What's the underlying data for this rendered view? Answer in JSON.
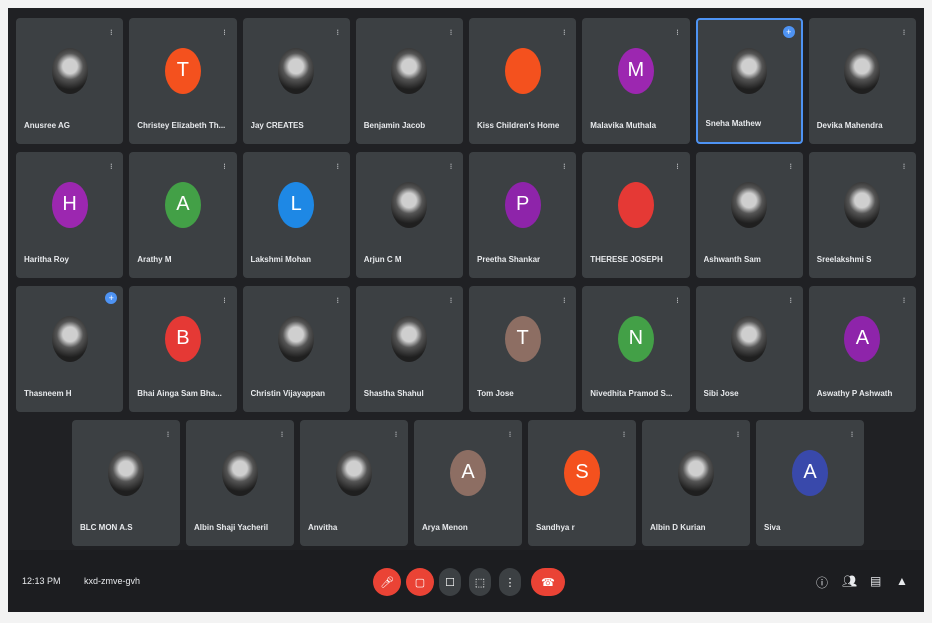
{
  "participants": [
    {
      "name": "Anusree AG",
      "avatar_letter": "",
      "avatar_color": "",
      "photo": true
    },
    {
      "name": "Christey Elizabeth Th...",
      "avatar_letter": "T",
      "avatar_color": "#f4511e",
      "photo": false
    },
    {
      "name": "Jay CREATES",
      "avatar_letter": "",
      "avatar_color": "",
      "photo": true
    },
    {
      "name": "Benjamin Jacob",
      "avatar_letter": "",
      "avatar_color": "",
      "photo": true
    },
    {
      "name": "Kiss Children's Home",
      "avatar_letter": "",
      "avatar_color": "#f4511e",
      "photo": false
    },
    {
      "name": "Malavika Muthala",
      "avatar_letter": "M",
      "avatar_color": "#9c27b0",
      "photo": false
    },
    {
      "name": "Sneha Mathew",
      "avatar_letter": "",
      "avatar_color": "",
      "photo": true
    },
    {
      "name": "Devika Mahendra",
      "avatar_letter": "",
      "avatar_color": "",
      "photo": true
    },
    {
      "name": "Haritha Roy",
      "avatar_letter": "H",
      "avatar_color": "#9c27b0",
      "photo": false
    },
    {
      "name": "Arathy M",
      "avatar_letter": "A",
      "avatar_color": "#43a047",
      "photo": false
    },
    {
      "name": "Lakshmi Mohan",
      "avatar_letter": "L",
      "avatar_color": "#1e88e5",
      "photo": false
    },
    {
      "name": "Arjun C M",
      "avatar_letter": "",
      "avatar_color": "",
      "photo": true
    },
    {
      "name": "Preetha Shankar",
      "avatar_letter": "P",
      "avatar_color": "#8e24aa",
      "photo": false
    },
    {
      "name": "THERESE JOSEPH",
      "avatar_letter": "",
      "avatar_color": "#e53935",
      "photo": false
    },
    {
      "name": "Ashwanth Sam",
      "avatar_letter": "",
      "avatar_color": "",
      "photo": true
    },
    {
      "name": "Sreelakshmi S",
      "avatar_letter": "",
      "avatar_color": "",
      "photo": true
    },
    {
      "name": "Thasneem H",
      "avatar_letter": "",
      "avatar_color": "",
      "photo": true
    },
    {
      "name": "Bhai Ainga Sam Bha...",
      "avatar_letter": "B",
      "avatar_color": "#e53935",
      "photo": false
    },
    {
      "name": "Christin Vijayappan",
      "avatar_letter": "",
      "avatar_color": "",
      "photo": true
    },
    {
      "name": "Shastha Shahul",
      "avatar_letter": "",
      "avatar_color": "",
      "photo": true
    },
    {
      "name": "Tom Jose",
      "avatar_letter": "T",
      "avatar_color": "#8d6e63",
      "photo": false
    },
    {
      "name": "Nivedhita Pramod S...",
      "avatar_letter": "N",
      "avatar_color": "#43a047",
      "photo": false
    },
    {
      "name": "Sibi Jose",
      "avatar_letter": "",
      "avatar_color": "",
      "photo": true
    },
    {
      "name": "Aswathy P Ashwath",
      "avatar_letter": "A",
      "avatar_color": "#8e24aa",
      "photo": false
    },
    {
      "name": "BLC MON A.S",
      "avatar_letter": "",
      "avatar_color": "",
      "photo": true
    },
    {
      "name": "Albin Shaji Yacheril",
      "avatar_letter": "",
      "avatar_color": "",
      "photo": true
    },
    {
      "name": "Anvitha",
      "avatar_letter": "",
      "avatar_color": "",
      "photo": true
    },
    {
      "name": "Arya Menon",
      "avatar_letter": "A",
      "avatar_color": "#8d6e63",
      "photo": false
    },
    {
      "name": "Sandhya r",
      "avatar_letter": "S",
      "avatar_color": "#f4511e",
      "photo": false
    },
    {
      "name": "Albin D Kurian",
      "avatar_letter": "",
      "avatar_color": "",
      "photo": true
    },
    {
      "name": "Siva",
      "avatar_letter": "A",
      "avatar_color": "#3949ab",
      "photo": false
    }
  ],
  "footer": {
    "time": "12:13 PM",
    "meeting_code": "kxd-zmve-gvh"
  }
}
